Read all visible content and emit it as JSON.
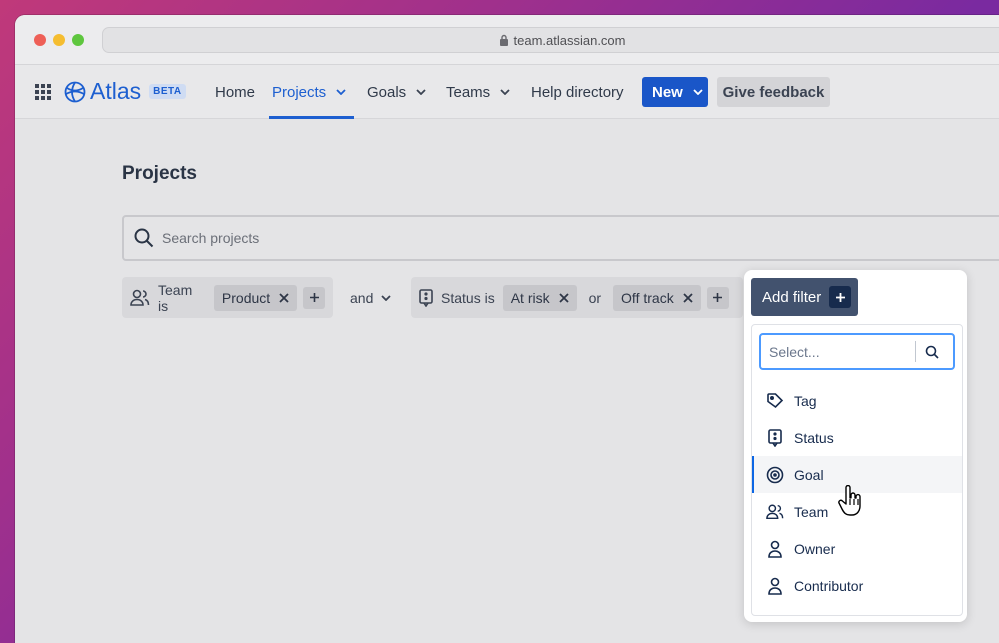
{
  "browser": {
    "url": "team.atlassian.com"
  },
  "nav": {
    "logo": "Atlas",
    "badge": "BETA",
    "items": [
      {
        "label": "Home"
      },
      {
        "label": "Projects"
      },
      {
        "label": "Goals"
      },
      {
        "label": "Teams"
      },
      {
        "label": "Help directory"
      }
    ],
    "new_label": "New",
    "feedback_label": "Give feedback"
  },
  "page": {
    "title": "Projects",
    "search_placeholder": "Search projects"
  },
  "filters": {
    "team": {
      "label": "Team is",
      "chips": [
        "Product"
      ]
    },
    "conjunction": "and",
    "status": {
      "label": "Status is",
      "chips": [
        "At risk",
        "Off track"
      ],
      "or_label": "or"
    }
  },
  "add_filter": {
    "button_label": "Add filter",
    "select_placeholder": "Select...",
    "options": [
      {
        "label": "Tag",
        "icon": "tag-icon"
      },
      {
        "label": "Status",
        "icon": "status-icon"
      },
      {
        "label": "Goal",
        "icon": "goal-icon"
      },
      {
        "label": "Team",
        "icon": "team-icon"
      },
      {
        "label": "Owner",
        "icon": "owner-icon"
      },
      {
        "label": "Contributor",
        "icon": "contributor-icon"
      }
    ],
    "hovered": "Goal"
  },
  "colors": {
    "brand": "#1d5fd0",
    "primary_button": "#1a56c8",
    "add_filter_button": "#42526e",
    "focus_ring": "#4c9aff"
  }
}
